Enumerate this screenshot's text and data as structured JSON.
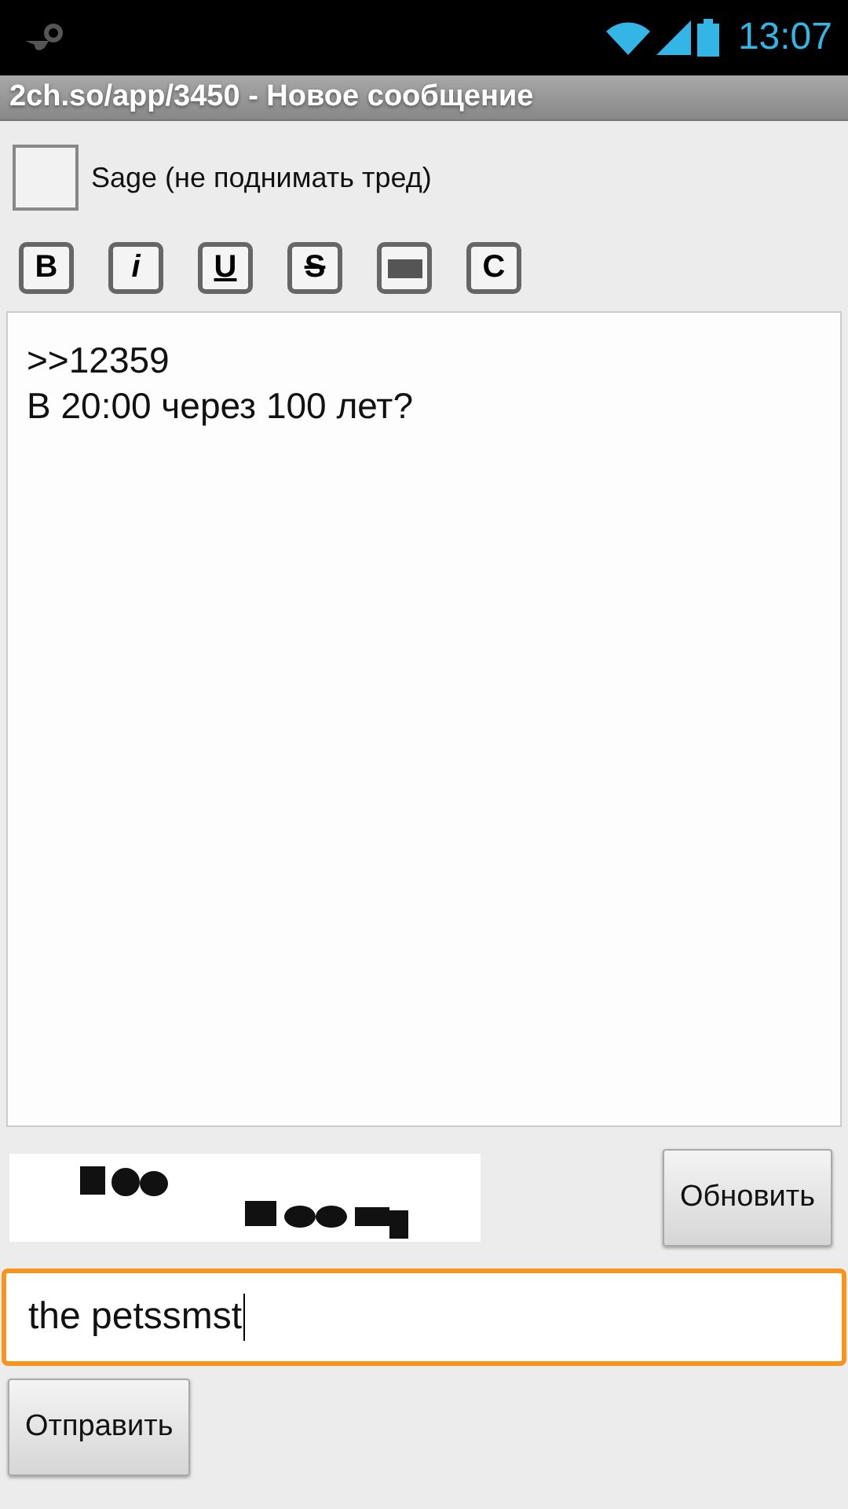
{
  "status_bar": {
    "time": "13:07"
  },
  "window": {
    "title": "2ch.so/app/3450 - Новое сообщение"
  },
  "sage": {
    "label": "Sage (не поднимать тред)",
    "checked": false
  },
  "format_buttons": [
    {
      "kind": "bold",
      "label": "B"
    },
    {
      "kind": "italic",
      "label": "i"
    },
    {
      "kind": "underline",
      "label": "U"
    },
    {
      "kind": "strike",
      "label": "S"
    },
    {
      "kind": "spoiler"
    },
    {
      "kind": "code",
      "label": "C"
    }
  ],
  "message": {
    "value": ">>12359\nВ 20:00 через 100 лет?"
  },
  "captcha": {
    "refresh_button": "Обновить"
  },
  "captcha_input": {
    "value": "the petssmst",
    "focused": true
  },
  "send_button": "Отправить"
}
